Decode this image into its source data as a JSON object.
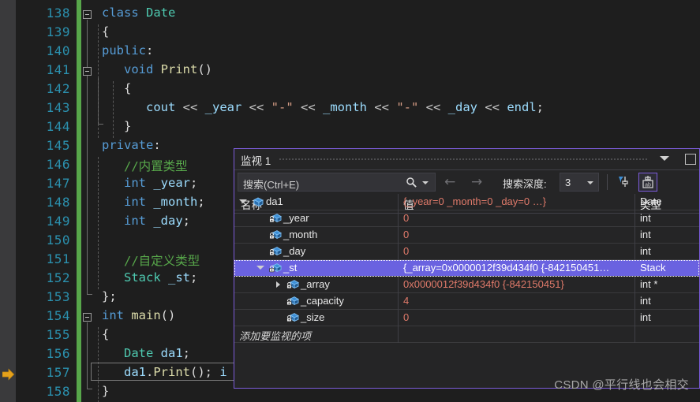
{
  "editor": {
    "change_bar_color": "#57a64a",
    "background": "#1e1e1e",
    "linenumber_color": "#2b91af",
    "current_line": 157,
    "lines": [
      {
        "num": "138",
        "indent": 0,
        "tokens": [
          [
            "k",
            "class "
          ],
          [
            "ty",
            "Date"
          ]
        ]
      },
      {
        "num": "139",
        "indent": 0,
        "tokens": [
          [
            "pn",
            "{"
          ]
        ]
      },
      {
        "num": "140",
        "indent": 0,
        "tokens": [
          [
            "k",
            "public"
          ],
          [
            "pn",
            ":"
          ]
        ]
      },
      {
        "num": "141",
        "indent": 1,
        "tokens": [
          [
            "k",
            "void "
          ],
          [
            "fn",
            "Print"
          ],
          [
            "pn",
            "()"
          ]
        ]
      },
      {
        "num": "142",
        "indent": 1,
        "tokens": [
          [
            "pn",
            "{"
          ]
        ]
      },
      {
        "num": "143",
        "indent": 2,
        "tokens": [
          [
            "id",
            "cout "
          ],
          [
            "ob",
            "<< "
          ],
          [
            "id",
            "_year "
          ],
          [
            "ob",
            "<< "
          ],
          [
            "st",
            "\"-\" "
          ],
          [
            "ob",
            "<< "
          ],
          [
            "id",
            "_month "
          ],
          [
            "ob",
            "<< "
          ],
          [
            "st",
            "\"-\" "
          ],
          [
            "ob",
            "<< "
          ],
          [
            "id",
            "_day "
          ],
          [
            "ob",
            "<< "
          ],
          [
            "id",
            "endl"
          ],
          [
            "pn",
            ";"
          ]
        ]
      },
      {
        "num": "144",
        "indent": 1,
        "tokens": [
          [
            "pn",
            "}"
          ]
        ]
      },
      {
        "num": "145",
        "indent": 0,
        "tokens": [
          [
            "k",
            "private"
          ],
          [
            "pn",
            ":"
          ]
        ]
      },
      {
        "num": "146",
        "indent": 1,
        "tokens": [
          [
            "cm",
            "//内置类型"
          ]
        ]
      },
      {
        "num": "147",
        "indent": 1,
        "tokens": [
          [
            "k",
            "int "
          ],
          [
            "id",
            "_year"
          ],
          [
            "pn",
            ";"
          ]
        ]
      },
      {
        "num": "148",
        "indent": 1,
        "tokens": [
          [
            "k",
            "int "
          ],
          [
            "id",
            "_month"
          ],
          [
            "pn",
            ";"
          ]
        ]
      },
      {
        "num": "149",
        "indent": 1,
        "tokens": [
          [
            "k",
            "int "
          ],
          [
            "id",
            "_day"
          ],
          [
            "pn",
            ";"
          ]
        ]
      },
      {
        "num": "150",
        "indent": 1,
        "tokens": []
      },
      {
        "num": "151",
        "indent": 1,
        "tokens": [
          [
            "cm",
            "//自定义类型"
          ]
        ]
      },
      {
        "num": "152",
        "indent": 1,
        "tokens": [
          [
            "ty",
            "Stack "
          ],
          [
            "id",
            "_st"
          ],
          [
            "pn",
            ";"
          ]
        ]
      },
      {
        "num": "153",
        "indent": 0,
        "tokens": [
          [
            "pn",
            "};"
          ]
        ]
      },
      {
        "num": "154",
        "indent": 0,
        "tokens": [
          [
            "k",
            "int "
          ],
          [
            "fn",
            "main"
          ],
          [
            "pn",
            "()"
          ]
        ]
      },
      {
        "num": "155",
        "indent": 0,
        "tokens": [
          [
            "pn",
            "{"
          ]
        ]
      },
      {
        "num": "156",
        "indent": 1,
        "tokens": [
          [
            "ty",
            "Date "
          ],
          [
            "id",
            "da1"
          ],
          [
            "pn",
            ";"
          ]
        ]
      },
      {
        "num": "157",
        "indent": 1,
        "tokens": [
          [
            "id",
            "da1"
          ],
          [
            "pn",
            "."
          ],
          [
            "fn",
            "Print"
          ],
          [
            "pn",
            "(); "
          ],
          [
            "id",
            "i"
          ]
        ]
      },
      {
        "num": "158",
        "indent": 0,
        "tokens": [
          [
            "pn",
            "}"
          ]
        ]
      }
    ]
  },
  "watch": {
    "title": "监视 1",
    "accent_color": "#7c5cdb",
    "selection_color": "#6a62e0",
    "value_color": "#e07a6a",
    "search": {
      "placeholder": "搜索(Ctrl+E)",
      "value": "",
      "icon": "search-icon",
      "dropdown_icon": "chevron-down-icon"
    },
    "nav_back_icon": "arrow-left-icon",
    "nav_forward_icon": "arrow-right-icon",
    "depth": {
      "label": "搜索深度:",
      "value": "3"
    },
    "buttons": [
      {
        "name": "filter-pin-button",
        "icon": "filter-pin-icon",
        "selected": false
      },
      {
        "name": "show-raw-values-button",
        "icon": "pin-ab-icon",
        "selected": true
      }
    ],
    "title_chevron_icon": "chevron-down-icon",
    "float_button_icon": "float-window-icon",
    "columns": [
      "名称",
      "值",
      "类型"
    ],
    "rows": [
      {
        "name": "da1",
        "value": "{_year=0 _month=0 _day=0 …}",
        "type": "Date",
        "depth": 0,
        "expander": "open",
        "icon": "class-object-icon",
        "selected": false
      },
      {
        "name": "_year",
        "value": "0",
        "type": "int",
        "depth": 1,
        "expander": "none",
        "icon": "private-field-icon",
        "selected": false
      },
      {
        "name": "_month",
        "value": "0",
        "type": "int",
        "depth": 1,
        "expander": "none",
        "icon": "private-field-icon",
        "selected": false
      },
      {
        "name": "_day",
        "value": "0",
        "type": "int",
        "depth": 1,
        "expander": "none",
        "icon": "private-field-icon",
        "selected": false
      },
      {
        "name": "_st",
        "value": "{_array=0x0000012f39d434f0 {-842150451…",
        "type": "Stack",
        "depth": 1,
        "expander": "open",
        "icon": "private-field-icon",
        "selected": true
      },
      {
        "name": "_array",
        "value": "0x0000012f39d434f0 {-842150451}",
        "type": "int *",
        "depth": 2,
        "expander": "closed",
        "icon": "private-field-icon",
        "selected": false
      },
      {
        "name": "_capacity",
        "value": "4",
        "type": "int",
        "depth": 2,
        "expander": "none",
        "icon": "private-field-icon",
        "selected": false
      },
      {
        "name": "_size",
        "value": "0",
        "type": "int",
        "depth": 2,
        "expander": "none",
        "icon": "private-field-icon",
        "selected": false
      }
    ],
    "add_row_placeholder": "添加要监视的项"
  },
  "watermark": "CSDN @平行线也会相交"
}
